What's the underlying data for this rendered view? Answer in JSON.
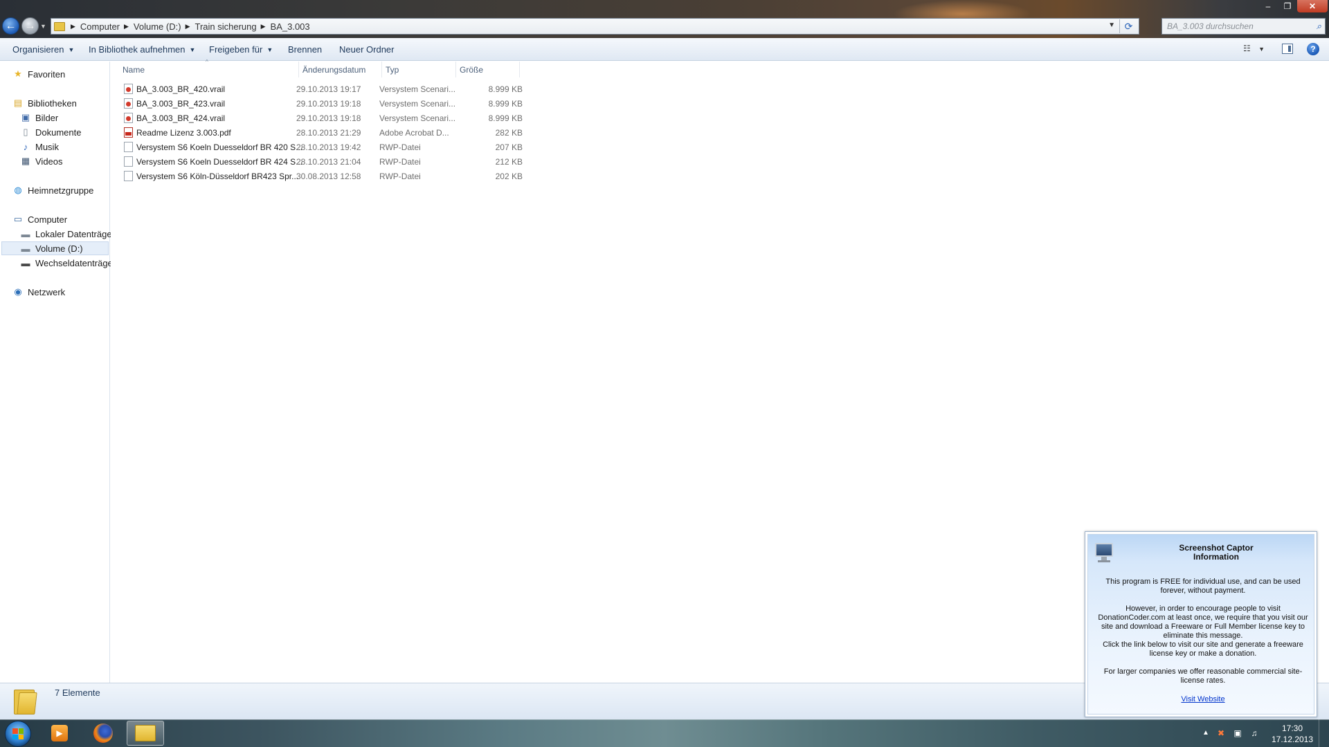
{
  "window": {
    "controls": {
      "minimize": "–",
      "maximize": "❐",
      "close": "✕"
    }
  },
  "address": {
    "breadcrumbs": [
      "Computer",
      "Volume (D:)",
      "Train sicherung",
      "BA_3.003"
    ]
  },
  "search": {
    "placeholder": "BA_3.003 durchsuchen"
  },
  "toolbar": {
    "organize": "Organisieren",
    "library": "In Bibliothek aufnehmen",
    "share": "Freigeben für",
    "burn": "Brennen",
    "new_folder": "Neuer Ordner",
    "help": "?"
  },
  "nav": {
    "favorites": "Favoriten",
    "libraries": "Bibliotheken",
    "pictures": "Bilder",
    "documents": "Dokumente",
    "music": "Musik",
    "videos": "Videos",
    "homegroup": "Heimnetzgruppe",
    "computer": "Computer",
    "local_disk": "Lokaler Datenträger",
    "volume_d": "Volume (D:)",
    "removable": "Wechseldatenträger",
    "network": "Netzwerk"
  },
  "columns": {
    "name": "Name",
    "date": "Änderungsdatum",
    "type": "Typ",
    "size": "Größe"
  },
  "files": [
    {
      "name": "BA_3.003_BR_420.vrail",
      "date": "29.10.2013 19:17",
      "type": "Versystem Scenari...",
      "size": "8.999 KB",
      "icon": "vrail-icon"
    },
    {
      "name": "BA_3.003_BR_423.vrail",
      "date": "29.10.2013 19:18",
      "type": "Versystem Scenari...",
      "size": "8.999 KB",
      "icon": "vrail-icon"
    },
    {
      "name": "BA_3.003_BR_424.vrail",
      "date": "29.10.2013 19:18",
      "type": "Versystem Scenari...",
      "size": "8.999 KB",
      "icon": "vrail-icon"
    },
    {
      "name": "Readme Lizenz 3.003.pdf",
      "date": "28.10.2013 21:29",
      "type": "Adobe Acrobat D...",
      "size": "282 KB",
      "icon": "pdf-icon"
    },
    {
      "name": "Versystem S6 Koeln Duesseldorf BR 420 S...",
      "date": "28.10.2013 19:42",
      "type": "RWP-Datei",
      "size": "207 KB",
      "icon": "file-icon"
    },
    {
      "name": "Versystem S6 Koeln Duesseldorf BR 424 S...",
      "date": "28.10.2013 21:04",
      "type": "RWP-Datei",
      "size": "212 KB",
      "icon": "file-icon"
    },
    {
      "name": "Versystem S6 Köln-Düsseldorf BR423 Spr...",
      "date": "30.08.2013 12:58",
      "type": "RWP-Datei",
      "size": "202 KB",
      "icon": "file-icon"
    }
  ],
  "status": {
    "count": "7 Elemente"
  },
  "popup": {
    "title_line1": "Screenshot Captor",
    "title_line2": "Information",
    "p1": "This program is FREE for individual use, and can be used forever, without payment.",
    "p2": "However, in order to encourage people to visit DonationCoder.com at least once, we require that you visit our site and download a Freeware or Full Member license key to eliminate this message.",
    "p3": "Click the link below to visit our site and generate a freeware license key or make a donation.",
    "p4": "For larger companies we offer reasonable commercial site-license rates.",
    "link": "Visit Website"
  },
  "taskbar": {
    "clock_time": "17:30",
    "clock_date": "17.12.2013"
  },
  "colors": {
    "accent": "#2b64b8",
    "link": "#0033cc",
    "close_button": "#c13b23"
  }
}
